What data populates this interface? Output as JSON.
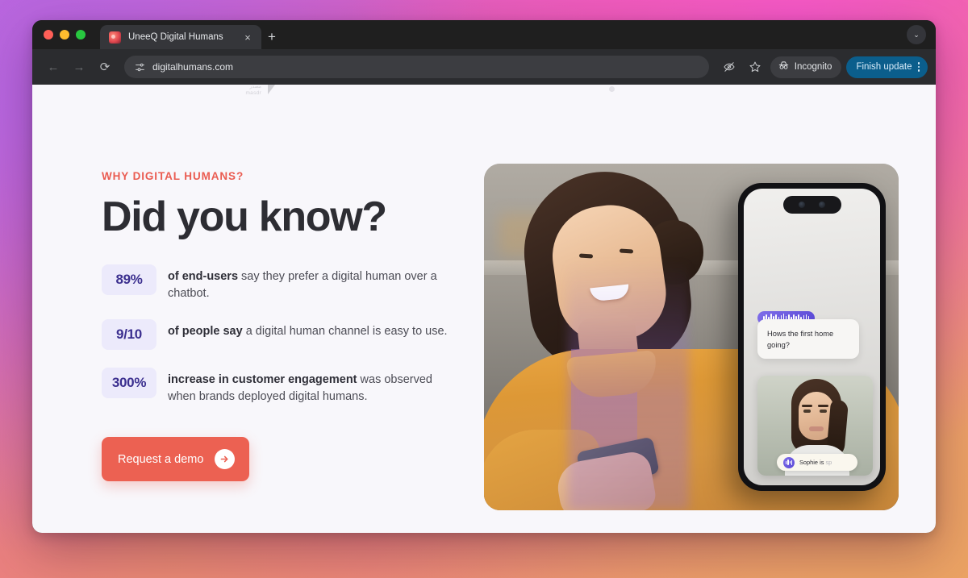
{
  "browser": {
    "tab": {
      "title": "UneeQ Digital Humans",
      "close_label": "×",
      "favicon": "uneeq-favicon"
    },
    "new_tab_label": "+",
    "window_chevron": "⌄",
    "nav": {
      "back": "←",
      "forward": "→",
      "reload": "⟳"
    },
    "omnibox": {
      "url": "digitalhumans.com",
      "site_settings_icon": "tune-icon"
    },
    "actions": {
      "tracking_protection": "eye-off-icon",
      "bookmark": "star-icon",
      "incognito_label": "Incognito",
      "update_label": "Finish update"
    }
  },
  "page": {
    "logo": {
      "arabic": "مصدر",
      "latin": "masdr"
    },
    "hero": {
      "eyebrow": "WHY  DIGITAL HUMANS?",
      "headline": "Did you know?",
      "stats": [
        {
          "value": "89%",
          "bold": "of end-users",
          "rest": " say they prefer a digital human over a chatbot."
        },
        {
          "value": "9/10",
          "bold": "of people say",
          "rest": " a digital human channel is easy to use."
        },
        {
          "value": "300%",
          "bold": "increase in customer engagement",
          "rest": " was observed when brands deployed digital humans."
        }
      ],
      "cta": {
        "label": "Request a demo",
        "arrow": "→"
      }
    },
    "phone": {
      "waveform_label": "voice-waveform",
      "chat_message": "Hows the first home going?",
      "speaking_name": "Sophie is",
      "speaking_ghost": "sp"
    }
  },
  "colors": {
    "accent_coral": "#ec6152",
    "eyebrow_red": "#ea5c51",
    "badge_bg": "#eceafb",
    "badge_text": "#3b2f8f",
    "headline": "#2d2d33",
    "update_blue": "#0b5e8c",
    "page_bg": "#f8f7fb"
  }
}
